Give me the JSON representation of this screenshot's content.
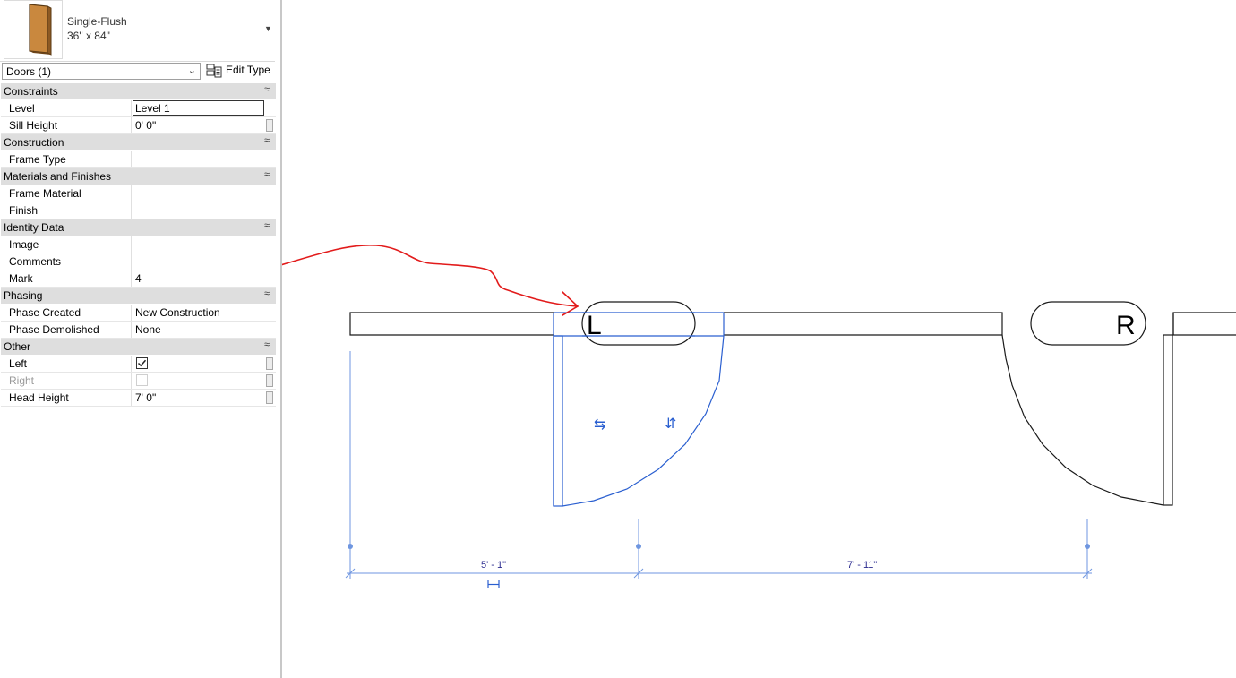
{
  "type_selector": {
    "family": "Single-Flush",
    "size": "36\" x 84\""
  },
  "instance_filter": {
    "label": "Doors (1)",
    "edit_type_label": "Edit Type"
  },
  "groups": {
    "constraints": "Constraints",
    "construction": "Construction",
    "materials": "Materials and Finishes",
    "identity": "Identity Data",
    "phasing": "Phasing",
    "other": "Other"
  },
  "props": {
    "level": {
      "name": "Level",
      "value": "Level 1"
    },
    "sill_height": {
      "name": "Sill Height",
      "value": "0'  0\""
    },
    "frame_type": {
      "name": "Frame Type",
      "value": ""
    },
    "frame_material": {
      "name": "Frame Material",
      "value": ""
    },
    "finish": {
      "name": "Finish",
      "value": ""
    },
    "image": {
      "name": "Image",
      "value": ""
    },
    "comments": {
      "name": "Comments",
      "value": ""
    },
    "mark": {
      "name": "Mark",
      "value": "4"
    },
    "phase_created": {
      "name": "Phase Created",
      "value": "New Construction"
    },
    "phase_demolished": {
      "name": "Phase Demolished",
      "value": "None"
    },
    "left": {
      "name": "Left",
      "checked": true
    },
    "right": {
      "name": "Right",
      "checked": false,
      "disabled": true
    },
    "head_height": {
      "name": "Head Height",
      "value": "7'  0\""
    }
  },
  "drawing": {
    "tag_left": "L",
    "tag_right": "R",
    "dim_1": "5' - 1\"",
    "dim_2": "7' - 11\""
  },
  "colors": {
    "selection_blue": "#2a5fd0",
    "annotation_red": "#e21b1b",
    "group_header": "#dedede"
  }
}
